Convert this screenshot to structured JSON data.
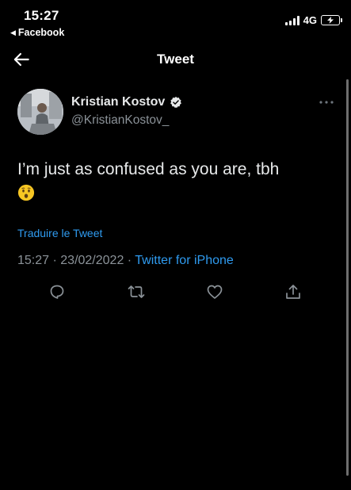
{
  "status_bar": {
    "time": "15:27",
    "back_app": "Facebook",
    "network": "4G",
    "icons": [
      "signal-icon",
      "battery-charging-icon"
    ]
  },
  "nav": {
    "title": "Tweet",
    "back_icon": "arrow-left-icon"
  },
  "tweet": {
    "author_name": "Kristian Kostov",
    "author_handle": "@KristianKostov_",
    "verified": true,
    "text": "I’m just as confused as you are, tbh",
    "emoji": "hushed-face-emoji",
    "translate_label": "Traduire le Tweet",
    "time": "15:27",
    "date": "23/02/2022",
    "separator": " · ",
    "source": "Twitter for iPhone"
  },
  "actions": [
    "reply-icon",
    "retweet-icon",
    "like-icon",
    "share-icon"
  ],
  "colors": {
    "background": "#000000",
    "text": "#e7e9ea",
    "secondary": "#8b9298",
    "link": "#2f9bf0",
    "icon": "#8b9298"
  }
}
